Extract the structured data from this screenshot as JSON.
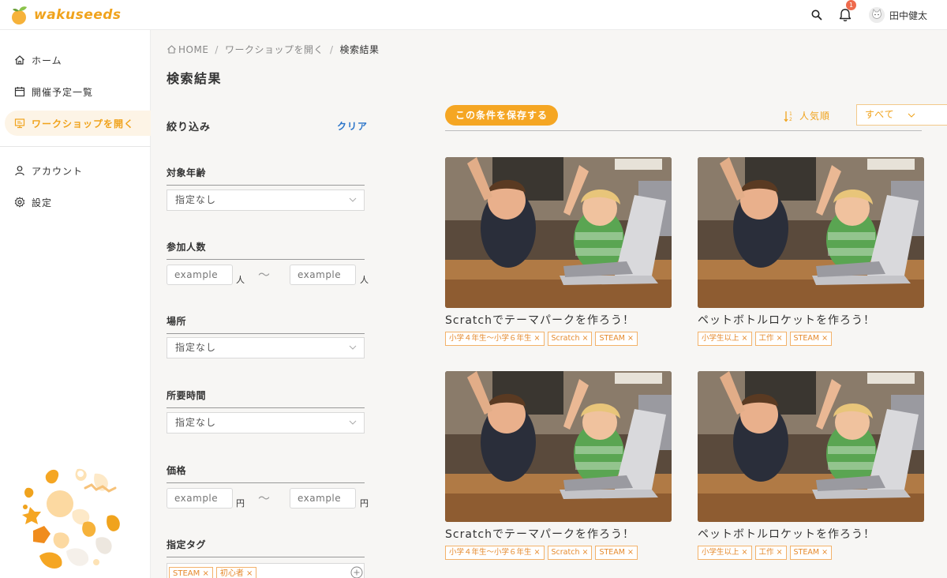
{
  "header": {
    "logo_text": "wakuseeds",
    "notification_count": "1",
    "user_name": "田中健太"
  },
  "sidebar": {
    "items": [
      {
        "label": "ホーム",
        "icon": "home-icon"
      },
      {
        "label": "開催予定一覧",
        "icon": "calendar-icon"
      },
      {
        "label": "ワークショップを開く",
        "icon": "presentation-icon",
        "active": true
      },
      {
        "label": "アカウント",
        "icon": "user-icon"
      },
      {
        "label": "設定",
        "icon": "gear-icon"
      }
    ]
  },
  "breadcrumb": {
    "items": [
      "HOME",
      "ワークショップを開く",
      "検索結果"
    ],
    "separator": "/"
  },
  "page_title": "検索結果",
  "filters": {
    "heading": "絞り込み",
    "clear_label": "クリア",
    "age": {
      "label": "対象年齢",
      "value": "指定なし"
    },
    "participants": {
      "label": "参加人数",
      "min_placeholder": "example",
      "max_placeholder": "example",
      "unit": "人"
    },
    "location": {
      "label": "場所",
      "value": "指定なし"
    },
    "duration": {
      "label": "所要時間",
      "value": "指定なし"
    },
    "price": {
      "label": "価格",
      "min_placeholder": "example",
      "max_placeholder": "example",
      "unit": "円"
    },
    "tags": {
      "label": "指定タグ",
      "values": [
        "STEAM",
        "初心者"
      ]
    },
    "tilde": "〜",
    "remove_glyph": "×"
  },
  "toolbar": {
    "save_label": "この条件を保存する",
    "sort_label": "人気順",
    "filter_value": "すべて"
  },
  "results": [
    {
      "title": "Scratchでテーマパークを作ろう！",
      "tags": [
        "小学４年生〜小学６年生",
        "Scratch",
        "STEAM"
      ]
    },
    {
      "title": "ペットボトルロケットを作ろう！",
      "tags": [
        "小学生以上",
        "工作",
        "STEAM"
      ]
    },
    {
      "title": "Scratchでテーマパークを作ろう！",
      "tags": [
        "小学４年生〜小学６年生",
        "Scratch",
        "STEAM"
      ]
    },
    {
      "title": "ペットボトルロケットを作ろう！",
      "tags": [
        "小学生以上",
        "工作",
        "STEAM"
      ]
    }
  ],
  "colors": {
    "accent": "#f5a623",
    "accent_text": "#f0a31d",
    "link": "#2a74c9",
    "badge": "#ee6b4d",
    "chip_border": "#f3b26a"
  }
}
